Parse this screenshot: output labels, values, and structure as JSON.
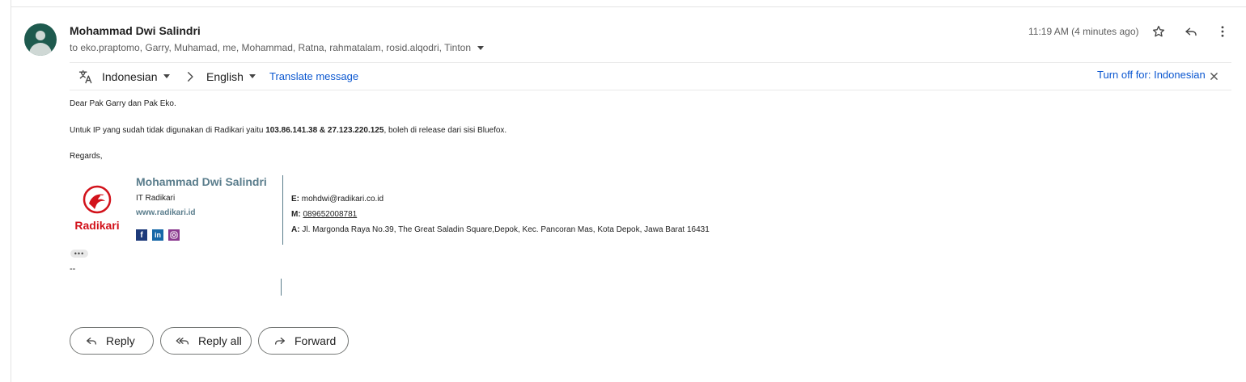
{
  "email": {
    "sender": "Mohammad Dwi Salindri",
    "recipients": "to eko.praptomo, Garry, Muhamad, me, Mohammad, Ratna, rahmatalam, rosid.alqodri, Tinton",
    "timestamp": "11:19 AM (4 minutes ago)"
  },
  "translate": {
    "source_language": "Indonesian",
    "target_language": "English",
    "translate_link": "Translate message",
    "turn_off_link": "Turn off for: Indonesian"
  },
  "body": {
    "greeting": "Dear Pak Garry dan Pak Eko.",
    "line_prefix": "Untuk IP yang sudah tidak digunakan di Radikari yaitu ",
    "line_ips": "103.86.141.38 & 27.123.220.125",
    "line_suffix": ", boleh di release dari sisi Bluefox.",
    "closing": "Regards,",
    "dashes": "--"
  },
  "signature": {
    "logo_text": "Radikari",
    "name": "Mohammad Dwi Salindri",
    "role": "IT Radikari",
    "website": "www.radikari.id",
    "email_label": "E:",
    "email_value": "mohdwi@radikari.co.id",
    "mobile_label": "M:",
    "mobile_value": "089652008781",
    "address_label": "A:",
    "address_value": "Jl. Margonda Raya No.39, The Great Saladin Square,Depok, Kec. Pancoran Mas, Kota Depok, Jawa Barat 16431",
    "social_icons": [
      "facebook-icon",
      "linkedin-icon",
      "instagram-icon"
    ]
  },
  "actions": {
    "reply": "Reply",
    "reply_all": "Reply all",
    "forward": "Forward"
  },
  "colors": {
    "link_blue": "#0b57d0",
    "signature_teal": "#5a7d8c",
    "brand_red": "#d2121b",
    "avatar_green": "#1e5a4e"
  }
}
